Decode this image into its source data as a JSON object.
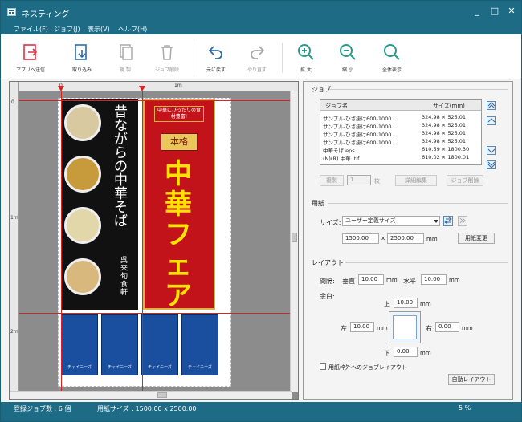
{
  "window": {
    "title": "ネスティング",
    "minimize": "_",
    "maximize": "□",
    "close": "✕"
  },
  "menu": [
    "ファイル(F)",
    "ジョブ(J)",
    "表示(V)",
    "ヘルプ(H)"
  ],
  "toolbar": {
    "send": "アプリへ送信",
    "import": "取り込み",
    "copy": "複 製",
    "delete": "ジョブ削除",
    "undo": "元に戻す",
    "redo": "やり直す",
    "zoom_in": "拡 大",
    "zoom_out": "縮 小",
    "fit": "全体表示"
  },
  "ruler": {
    "h0": "0",
    "h1": "1m",
    "v0": "0",
    "v1": "1m",
    "v2": "2m"
  },
  "poster1": {
    "text": "昔ながらの中華そば",
    "sub": "呉来旬食軒"
  },
  "poster2": {
    "small": "中華にぴったりの食材豊富!",
    "badge": "本格",
    "main": "中華フェア"
  },
  "small_jobs": [
    "チャイニーズ",
    "チャイニーズ",
    "チャイニーズ",
    "チャイニーズ"
  ],
  "job_section": {
    "title": "ジョブ",
    "col_name": "ジョブ名",
    "col_size": "サイズ(mm)",
    "rows": [
      {
        "name": "サンプル-ひざ掛け600-1000...",
        "size": "324.98 × 525.01"
      },
      {
        "name": "サンプル-ひざ掛け600-1000...",
        "size": "324.98 × 525.01"
      },
      {
        "name": "サンプル-ひざ掛け600-1000...",
        "size": "324.98 × 525.01"
      },
      {
        "name": "サンプル-ひざ掛け600-1000...",
        "size": "324.98 × 525.01"
      },
      {
        "name": "中華そば.eps",
        "size": "610.59 × 1800.30"
      },
      {
        "name": "(N)(R) 中華 .tif",
        "size": "610.02 × 1800.01"
      }
    ],
    "copy_label": "複製",
    "copy_count": "1",
    "copy_unit": "枚",
    "detail_edit": "詳細編集",
    "job_delete": "ジョブ削除"
  },
  "paper_section": {
    "title": "用紙",
    "size_label": "サイズ:",
    "size_value": "ユーザー定義サイズ",
    "width": "1500.00",
    "times": "x",
    "height": "2500.00",
    "unit": "mm",
    "change": "用紙変更"
  },
  "layout_section": {
    "title": "レイアウト",
    "spacing_label": "間隔:",
    "vertical_label": "垂直",
    "vertical_value": "10.00",
    "horizontal_label": "水平",
    "horizontal_value": "10.00",
    "unit": "mm",
    "margin_label": "余白:",
    "top_label": "上",
    "top_value": "10.00",
    "left_label": "左",
    "left_value": "10.00",
    "right_label": "右",
    "right_value": "0.00",
    "bottom_label": "下",
    "bottom_value": "0.00",
    "outside_checkbox": "用紙枠外へのジョブレイアウト",
    "auto_layout": "自動レイアウト"
  },
  "status": {
    "jobs": "登録ジョブ数 : 6 個",
    "paper": "用紙サイズ : 1500.00 x 2500.00",
    "zoom": "5 %"
  },
  "colors": {
    "titlebar": "#1e6b86",
    "guide": "#e02020",
    "poster_red": "#c2121a",
    "accent_blue": "#2d6aa6"
  }
}
